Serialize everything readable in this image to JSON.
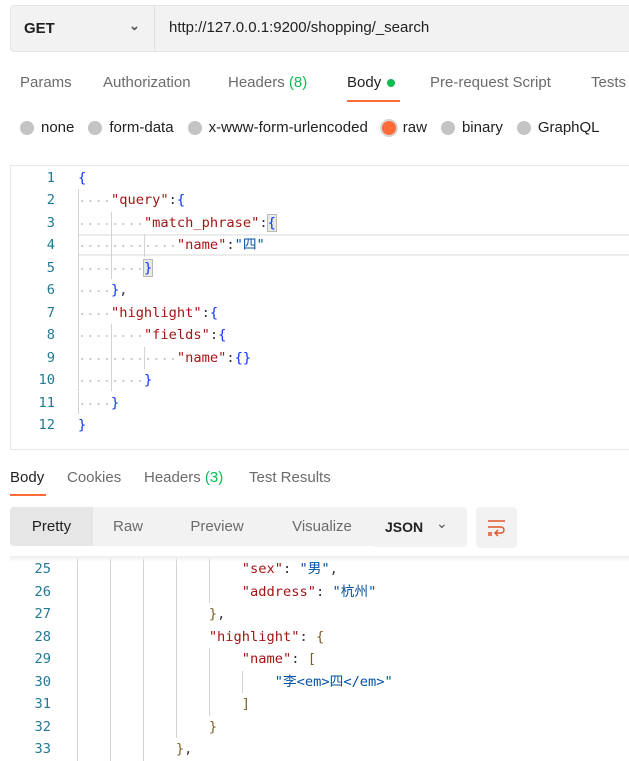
{
  "request": {
    "method": "GET",
    "url": "http://127.0.0.1:9200/shopping/_search"
  },
  "request_tabs": [
    {
      "label": "Params"
    },
    {
      "label": "Authorization"
    },
    {
      "label": "Headers",
      "count": "(8)"
    },
    {
      "label": "Body",
      "active": true,
      "dot": true
    },
    {
      "label": "Pre-request Script"
    },
    {
      "label": "Tests"
    }
  ],
  "body_types": [
    {
      "label": "none"
    },
    {
      "label": "form-data"
    },
    {
      "label": "x-www-form-urlencoded"
    },
    {
      "label": "raw",
      "selected": true
    },
    {
      "label": "binary"
    },
    {
      "label": "GraphQL"
    }
  ],
  "request_body": {
    "first_line": 1,
    "current_line": 4,
    "lines": [
      "{",
      "    \"query\":{",
      "        \"match_phrase\":{",
      "            \"name\":\"四\"",
      "        }",
      "    },",
      "    \"highlight\":{",
      "        \"fields\":{",
      "            \"name\":{}",
      "        }",
      "    }",
      "}"
    ]
  },
  "response_tabs": [
    {
      "label": "Body",
      "active": true
    },
    {
      "label": "Cookies"
    },
    {
      "label": "Headers",
      "count": "(3)"
    },
    {
      "label": "Test Results"
    }
  ],
  "view_modes": [
    "Pretty",
    "Raw",
    "Preview",
    "Visualize"
  ],
  "active_view_mode": "Pretty",
  "format": "JSON",
  "icons": {
    "method_dropdown": "chevron-down-icon",
    "format_dropdown": "chevron-down-icon",
    "wrap": "wrap-lines-icon"
  },
  "colors": {
    "accent": "#ff6c37",
    "count": "#0cbb52"
  },
  "response_body": {
    "first_line": 25,
    "lines": [
      "                        \"sex\": \"男\",",
      "                        \"address\": \"杭州\"",
      "                    },",
      "                    \"highlight\": {",
      "                        \"name\": [",
      "                            \"李<em>四</em>\"",
      "                        ]",
      "                    }",
      "                },"
    ]
  }
}
